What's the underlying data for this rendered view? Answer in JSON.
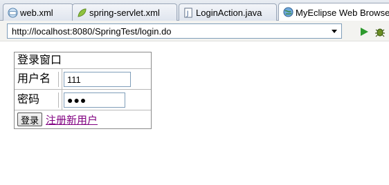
{
  "tabs": [
    {
      "label": "web.xml",
      "icon": "xml-file-icon"
    },
    {
      "label": "spring-servlet.xml",
      "icon": "spring-leaf-icon"
    },
    {
      "label": "LoginAction.java",
      "icon": "java-file-icon"
    },
    {
      "label": "MyEclipse Web Browse",
      "icon": "globe-icon",
      "active": true
    }
  ],
  "address": {
    "url": "http://localhost:8080/SpringTest/login.do"
  },
  "toolbar": {
    "run_icon": "run-icon",
    "debug_icon": "debug-icon"
  },
  "login": {
    "title": "登录窗口",
    "username_label": "用户名",
    "username_value": "111",
    "password_label": "密码",
    "password_value": "●●●",
    "submit_label": "登录",
    "register_link": "注册新用户"
  },
  "colors": {
    "link_visited": "#800080",
    "run_green": "#2e9a2e"
  }
}
